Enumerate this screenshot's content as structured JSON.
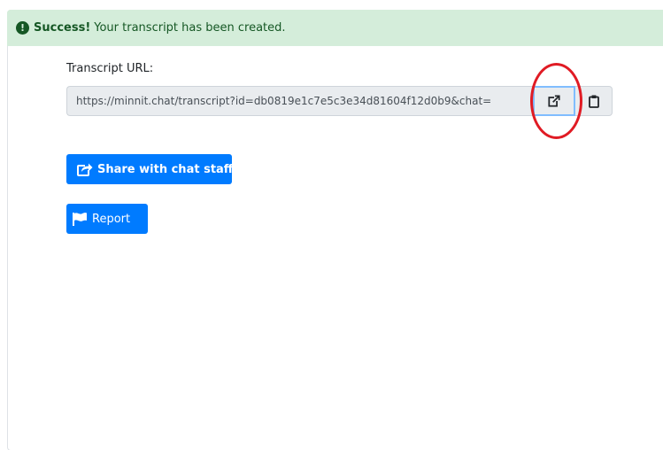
{
  "alert": {
    "icon": "exclamation-circle-icon",
    "strong": "Success!",
    "message": "Your transcript has been created.",
    "colors": {
      "background": "#d4edda",
      "text": "#155724"
    }
  },
  "transcript": {
    "label": "Transcript URL:",
    "url": "https://minnit.chat/transcript?id=db0819e1c7e5c3e34d81604f12d0b9&chat=",
    "open_icon": "external-link-icon",
    "copy_icon": "clipboard-icon"
  },
  "actions": {
    "share_label": "Share with chat staff",
    "share_icon": "share-square-icon",
    "report_label": "Report",
    "report_icon": "flag-icon"
  },
  "colors": {
    "primary": "#007bff",
    "annotation": "#e01b24"
  }
}
